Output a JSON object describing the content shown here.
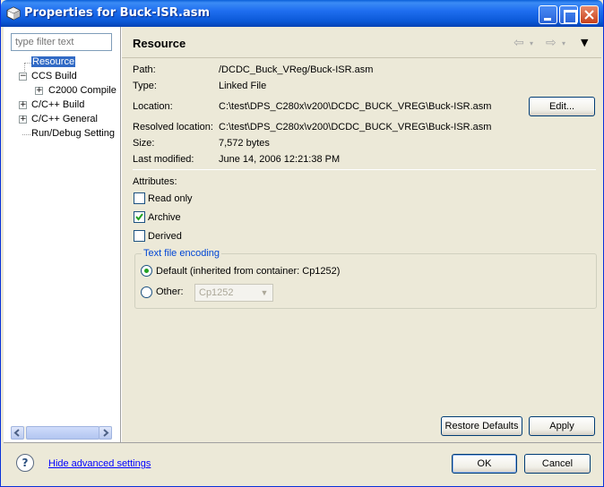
{
  "window": {
    "title": "Properties for Buck-ISR.asm"
  },
  "sidebar": {
    "filter_placeholder": "type filter text",
    "items": [
      {
        "label": "Resource",
        "selected": true
      },
      {
        "label": "CCS Build",
        "expanded": true
      },
      {
        "label": "C2000 Compile",
        "expanded": false
      },
      {
        "label": "C/C++ Build",
        "expanded": false
      },
      {
        "label": "C/C++ General",
        "expanded": false
      },
      {
        "label": "Run/Debug Setting"
      }
    ]
  },
  "page": {
    "title": "Resource",
    "path_label": "Path:",
    "path_value": "/DCDC_Buck_VReg/Buck-ISR.asm",
    "type_label": "Type:",
    "type_value": "Linked File",
    "location_label": "Location:",
    "location_value": "C:\\test\\DPS_C280x\\v200\\DCDC_BUCK_VREG\\Buck-ISR.asm",
    "edit_button": "Edit...",
    "resolved_label": "Resolved location:",
    "resolved_value": "C:\\test\\DPS_C280x\\v200\\DCDC_BUCK_VREG\\Buck-ISR.asm",
    "size_label": "Size:",
    "size_value": "7,572  bytes",
    "modified_label": "Last modified:",
    "modified_value": "June 14, 2006 12:21:38 PM",
    "attributes_label": "Attributes:",
    "read_only_label": "Read only",
    "read_only_checked": false,
    "archive_label": "Archive",
    "archive_checked": true,
    "derived_label": "Derived",
    "derived_checked": false,
    "encoding_group_title": "Text file encoding",
    "default_label": "Default (inherited from container: Cp1252)",
    "default_selected": true,
    "other_label": "Other:",
    "other_value": "Cp1252",
    "restore_defaults_button": "Restore Defaults",
    "apply_button": "Apply"
  },
  "footer": {
    "help_symbol": "?",
    "advanced_link": "Hide advanced settings",
    "ok_button": "OK",
    "cancel_button": "Cancel"
  },
  "colors": {
    "titlebar": "#1f6ef0",
    "selection": "#316ac5",
    "link": "#0000ff",
    "group_title": "#0046d5"
  }
}
